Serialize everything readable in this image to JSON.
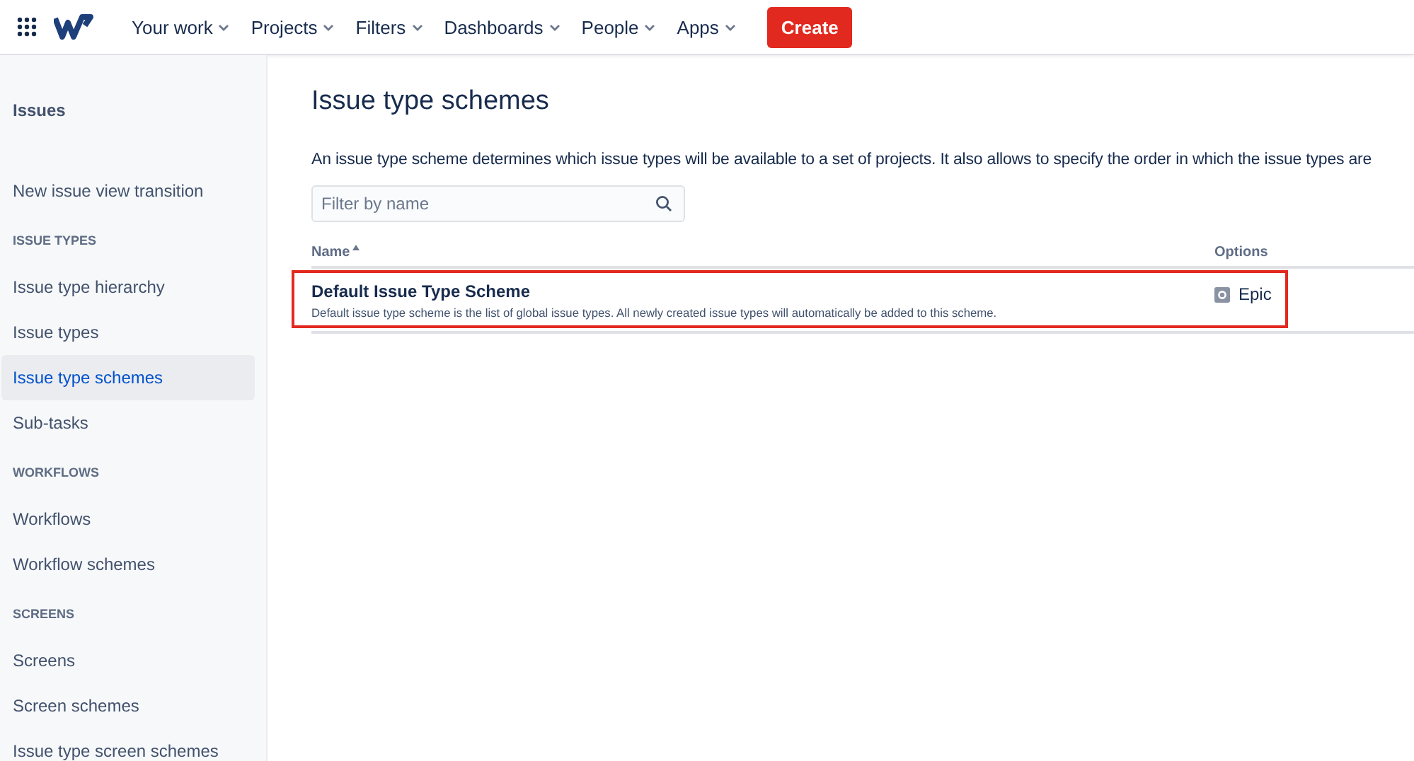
{
  "topnav": {
    "items": [
      {
        "label": "Your work"
      },
      {
        "label": "Projects"
      },
      {
        "label": "Filters"
      },
      {
        "label": "Dashboards"
      },
      {
        "label": "People"
      },
      {
        "label": "Apps"
      }
    ],
    "create_button": "Create"
  },
  "sidebar": {
    "title": "Issues",
    "items": [
      {
        "kind": "link",
        "label": "New issue view transition",
        "selected": false
      },
      {
        "kind": "heading",
        "label": "ISSUE TYPES"
      },
      {
        "kind": "link",
        "label": "Issue type hierarchy",
        "selected": false
      },
      {
        "kind": "link",
        "label": "Issue types",
        "selected": false
      },
      {
        "kind": "link",
        "label": "Issue type schemes",
        "selected": true
      },
      {
        "kind": "link",
        "label": "Sub-tasks",
        "selected": false
      },
      {
        "kind": "heading",
        "label": "WORKFLOWS"
      },
      {
        "kind": "link",
        "label": "Workflows",
        "selected": false
      },
      {
        "kind": "link",
        "label": "Workflow schemes",
        "selected": false
      },
      {
        "kind": "heading",
        "label": "SCREENS"
      },
      {
        "kind": "link",
        "label": "Screens",
        "selected": false
      },
      {
        "kind": "link",
        "label": "Screen schemes",
        "selected": false
      },
      {
        "kind": "link",
        "label": "Issue type screen schemes",
        "selected": false
      }
    ]
  },
  "page": {
    "title": "Issue type schemes",
    "description": "An issue type scheme determines which issue types will be available to a set of projects. It also allows to specify the order in which the issue types are",
    "search": {
      "placeholder": "Filter by name"
    },
    "table": {
      "columns": [
        "Name",
        "Options"
      ],
      "rows": [
        {
          "name": "Default Issue Type Scheme",
          "description": "Default issue type scheme is the list of global issue types. All newly created issue types will automatically be added to this scheme.",
          "issue_type": "Epic",
          "highlighted": true
        }
      ]
    }
  }
}
